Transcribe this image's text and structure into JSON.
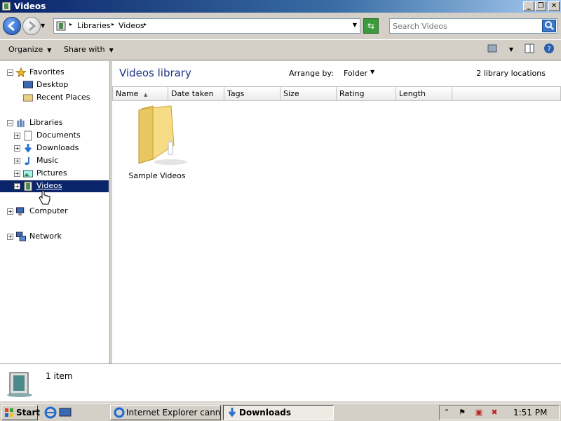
{
  "window": {
    "title": "Videos"
  },
  "address": {
    "crumbs": [
      "Libraries",
      "Videos"
    ],
    "search_placeholder": "Search Videos"
  },
  "toolbar": {
    "organize": "Organize",
    "share_with": "Share with"
  },
  "nav": {
    "favorites": "Favorites",
    "desktop": "Desktop",
    "recent_places": "Recent Places",
    "libraries": "Libraries",
    "documents": "Documents",
    "downloads": "Downloads",
    "music": "Music",
    "pictures": "Pictures",
    "videos": "Videos",
    "computer": "Computer",
    "network": "Network",
    "selected": "Videos"
  },
  "content": {
    "title": "Videos library",
    "arrange_label": "Arrange by:",
    "arrange_value": "Folder",
    "locations": "2 library locations",
    "columns": [
      "Name",
      "Date taken",
      "Tags",
      "Size",
      "Rating",
      "Length"
    ],
    "items": [
      {
        "name": "Sample Videos",
        "type": "folder"
      }
    ]
  },
  "details": {
    "count": "1 item"
  },
  "taskbar": {
    "start": "Start",
    "tasks": [
      {
        "label": "Internet Explorer cannot...",
        "active": false
      },
      {
        "label": "Downloads",
        "active": true
      }
    ],
    "clock": "1:51 PM"
  },
  "colors": {
    "title_gradient_start": "#0a246a",
    "selection": "#0a246a",
    "library_title": "#1e3287"
  }
}
